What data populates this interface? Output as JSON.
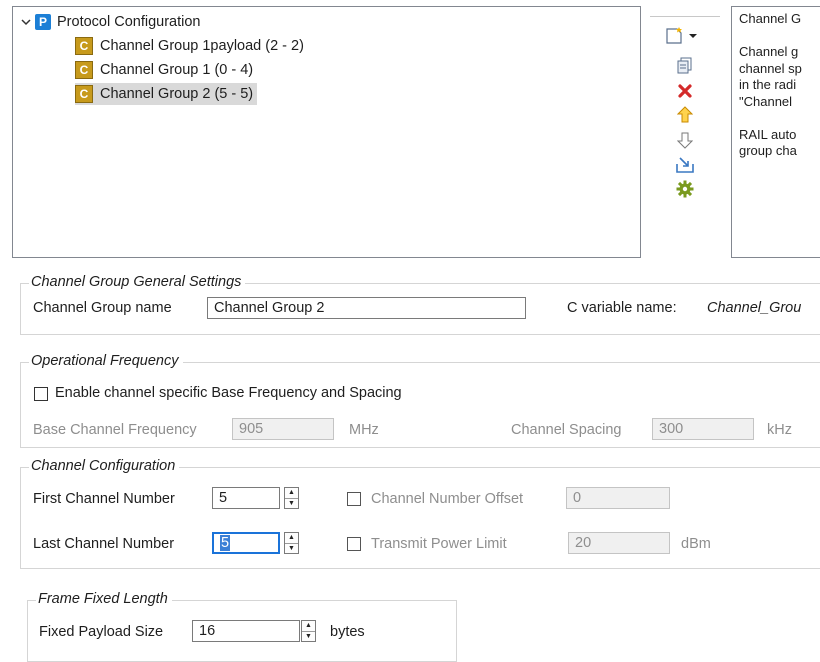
{
  "tree": {
    "root": {
      "icon_letter": "P",
      "label": "Protocol Configuration"
    },
    "items": [
      {
        "icon_letter": "C",
        "label": "Channel Group 1payload  (2 - 2)"
      },
      {
        "icon_letter": "C",
        "label": "Channel Group 1  (0 - 4)"
      },
      {
        "icon_letter": "C",
        "label": "Channel Group 2  (5 - 5)"
      }
    ]
  },
  "toolbar": {
    "icons": [
      "new-item-dropdown-icon",
      "copy-icon",
      "delete-icon",
      "move-up-icon",
      "move-down-icon",
      "import-icon",
      "settings-gear-icon"
    ]
  },
  "description": {
    "lines": [
      "Channel G",
      "",
      "Channel g",
      "channel sp",
      "in the radi",
      "\"Channel",
      "",
      "RAIL auto",
      "group cha"
    ]
  },
  "general_settings": {
    "title": "Channel Group General Settings",
    "name_label": "Channel Group name",
    "name_value": "Channel Group 2",
    "cvar_label": "C variable name:",
    "cvar_value": "Channel_Grou"
  },
  "operational_frequency": {
    "title": "Operational Frequency",
    "enable_label": "Enable channel specific Base Frequency and Spacing",
    "enable_checked": false,
    "base_label": "Base Channel Frequency",
    "base_value": "905",
    "base_unit": "MHz",
    "spacing_label": "Channel Spacing",
    "spacing_value": "300",
    "spacing_unit": "kHz"
  },
  "channel_configuration": {
    "title": "Channel Configuration",
    "first_label": "First Channel Number",
    "first_value": "5",
    "last_label": "Last Channel Number",
    "last_value": "5",
    "offset_label": "Channel Number Offset",
    "offset_value": "0",
    "power_label": "Transmit Power Limit",
    "power_value": "20",
    "power_unit": "dBm"
  },
  "frame_fixed_length": {
    "title": "Frame Fixed Length",
    "payload_label": "Fixed Payload Size",
    "payload_value": "16",
    "payload_unit": "bytes"
  }
}
